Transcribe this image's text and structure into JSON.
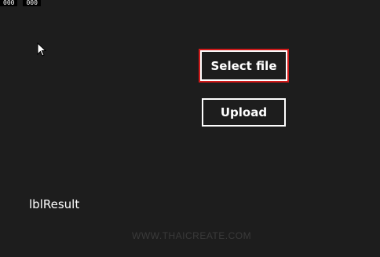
{
  "debug_counters": [
    "000",
    "000"
  ],
  "buttons": {
    "select_file_label": "Select file",
    "upload_label": "Upload"
  },
  "result_label": "lblResult",
  "watermark": "WWW.THAICREATE.COM",
  "colors": {
    "background": "#1d1d1d",
    "focus_border": "#d11a1a",
    "text": "#ffffff"
  },
  "icons": {
    "cursor": "mouse-pointer-icon"
  }
}
